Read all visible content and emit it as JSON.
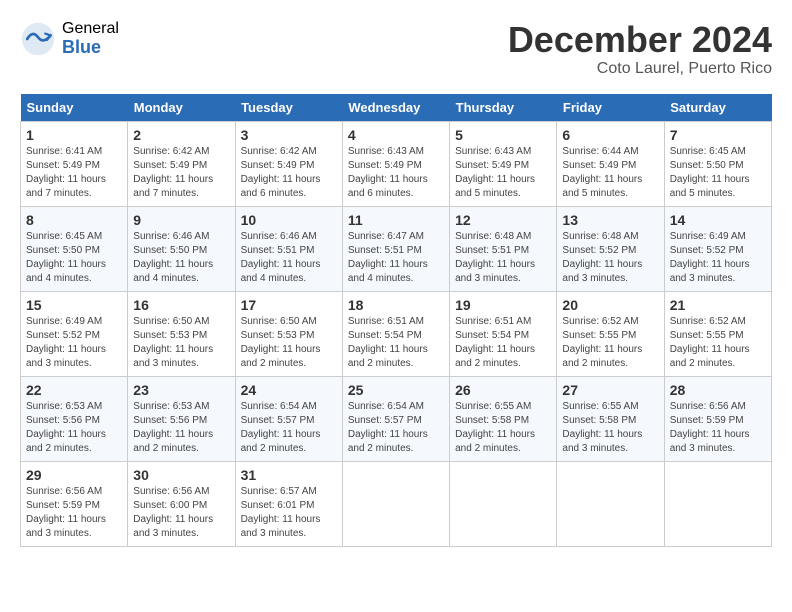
{
  "header": {
    "logo_general": "General",
    "logo_blue": "Blue",
    "month_title": "December 2024",
    "location": "Coto Laurel, Puerto Rico"
  },
  "days_of_week": [
    "Sunday",
    "Monday",
    "Tuesday",
    "Wednesday",
    "Thursday",
    "Friday",
    "Saturday"
  ],
  "weeks": [
    [
      {
        "day": "1",
        "sunrise": "Sunrise: 6:41 AM",
        "sunset": "Sunset: 5:49 PM",
        "daylight": "Daylight: 11 hours and 7 minutes."
      },
      {
        "day": "2",
        "sunrise": "Sunrise: 6:42 AM",
        "sunset": "Sunset: 5:49 PM",
        "daylight": "Daylight: 11 hours and 7 minutes."
      },
      {
        "day": "3",
        "sunrise": "Sunrise: 6:42 AM",
        "sunset": "Sunset: 5:49 PM",
        "daylight": "Daylight: 11 hours and 6 minutes."
      },
      {
        "day": "4",
        "sunrise": "Sunrise: 6:43 AM",
        "sunset": "Sunset: 5:49 PM",
        "daylight": "Daylight: 11 hours and 6 minutes."
      },
      {
        "day": "5",
        "sunrise": "Sunrise: 6:43 AM",
        "sunset": "Sunset: 5:49 PM",
        "daylight": "Daylight: 11 hours and 5 minutes."
      },
      {
        "day": "6",
        "sunrise": "Sunrise: 6:44 AM",
        "sunset": "Sunset: 5:49 PM",
        "daylight": "Daylight: 11 hours and 5 minutes."
      },
      {
        "day": "7",
        "sunrise": "Sunrise: 6:45 AM",
        "sunset": "Sunset: 5:50 PM",
        "daylight": "Daylight: 11 hours and 5 minutes."
      }
    ],
    [
      {
        "day": "8",
        "sunrise": "Sunrise: 6:45 AM",
        "sunset": "Sunset: 5:50 PM",
        "daylight": "Daylight: 11 hours and 4 minutes."
      },
      {
        "day": "9",
        "sunrise": "Sunrise: 6:46 AM",
        "sunset": "Sunset: 5:50 PM",
        "daylight": "Daylight: 11 hours and 4 minutes."
      },
      {
        "day": "10",
        "sunrise": "Sunrise: 6:46 AM",
        "sunset": "Sunset: 5:51 PM",
        "daylight": "Daylight: 11 hours and 4 minutes."
      },
      {
        "day": "11",
        "sunrise": "Sunrise: 6:47 AM",
        "sunset": "Sunset: 5:51 PM",
        "daylight": "Daylight: 11 hours and 4 minutes."
      },
      {
        "day": "12",
        "sunrise": "Sunrise: 6:48 AM",
        "sunset": "Sunset: 5:51 PM",
        "daylight": "Daylight: 11 hours and 3 minutes."
      },
      {
        "day": "13",
        "sunrise": "Sunrise: 6:48 AM",
        "sunset": "Sunset: 5:52 PM",
        "daylight": "Daylight: 11 hours and 3 minutes."
      },
      {
        "day": "14",
        "sunrise": "Sunrise: 6:49 AM",
        "sunset": "Sunset: 5:52 PM",
        "daylight": "Daylight: 11 hours and 3 minutes."
      }
    ],
    [
      {
        "day": "15",
        "sunrise": "Sunrise: 6:49 AM",
        "sunset": "Sunset: 5:52 PM",
        "daylight": "Daylight: 11 hours and 3 minutes."
      },
      {
        "day": "16",
        "sunrise": "Sunrise: 6:50 AM",
        "sunset": "Sunset: 5:53 PM",
        "daylight": "Daylight: 11 hours and 3 minutes."
      },
      {
        "day": "17",
        "sunrise": "Sunrise: 6:50 AM",
        "sunset": "Sunset: 5:53 PM",
        "daylight": "Daylight: 11 hours and 2 minutes."
      },
      {
        "day": "18",
        "sunrise": "Sunrise: 6:51 AM",
        "sunset": "Sunset: 5:54 PM",
        "daylight": "Daylight: 11 hours and 2 minutes."
      },
      {
        "day": "19",
        "sunrise": "Sunrise: 6:51 AM",
        "sunset": "Sunset: 5:54 PM",
        "daylight": "Daylight: 11 hours and 2 minutes."
      },
      {
        "day": "20",
        "sunrise": "Sunrise: 6:52 AM",
        "sunset": "Sunset: 5:55 PM",
        "daylight": "Daylight: 11 hours and 2 minutes."
      },
      {
        "day": "21",
        "sunrise": "Sunrise: 6:52 AM",
        "sunset": "Sunset: 5:55 PM",
        "daylight": "Daylight: 11 hours and 2 minutes."
      }
    ],
    [
      {
        "day": "22",
        "sunrise": "Sunrise: 6:53 AM",
        "sunset": "Sunset: 5:56 PM",
        "daylight": "Daylight: 11 hours and 2 minutes."
      },
      {
        "day": "23",
        "sunrise": "Sunrise: 6:53 AM",
        "sunset": "Sunset: 5:56 PM",
        "daylight": "Daylight: 11 hours and 2 minutes."
      },
      {
        "day": "24",
        "sunrise": "Sunrise: 6:54 AM",
        "sunset": "Sunset: 5:57 PM",
        "daylight": "Daylight: 11 hours and 2 minutes."
      },
      {
        "day": "25",
        "sunrise": "Sunrise: 6:54 AM",
        "sunset": "Sunset: 5:57 PM",
        "daylight": "Daylight: 11 hours and 2 minutes."
      },
      {
        "day": "26",
        "sunrise": "Sunrise: 6:55 AM",
        "sunset": "Sunset: 5:58 PM",
        "daylight": "Daylight: 11 hours and 2 minutes."
      },
      {
        "day": "27",
        "sunrise": "Sunrise: 6:55 AM",
        "sunset": "Sunset: 5:58 PM",
        "daylight": "Daylight: 11 hours and 3 minutes."
      },
      {
        "day": "28",
        "sunrise": "Sunrise: 6:56 AM",
        "sunset": "Sunset: 5:59 PM",
        "daylight": "Daylight: 11 hours and 3 minutes."
      }
    ],
    [
      {
        "day": "29",
        "sunrise": "Sunrise: 6:56 AM",
        "sunset": "Sunset: 5:59 PM",
        "daylight": "Daylight: 11 hours and 3 minutes."
      },
      {
        "day": "30",
        "sunrise": "Sunrise: 6:56 AM",
        "sunset": "Sunset: 6:00 PM",
        "daylight": "Daylight: 11 hours and 3 minutes."
      },
      {
        "day": "31",
        "sunrise": "Sunrise: 6:57 AM",
        "sunset": "Sunset: 6:01 PM",
        "daylight": "Daylight: 11 hours and 3 minutes."
      },
      null,
      null,
      null,
      null
    ]
  ]
}
